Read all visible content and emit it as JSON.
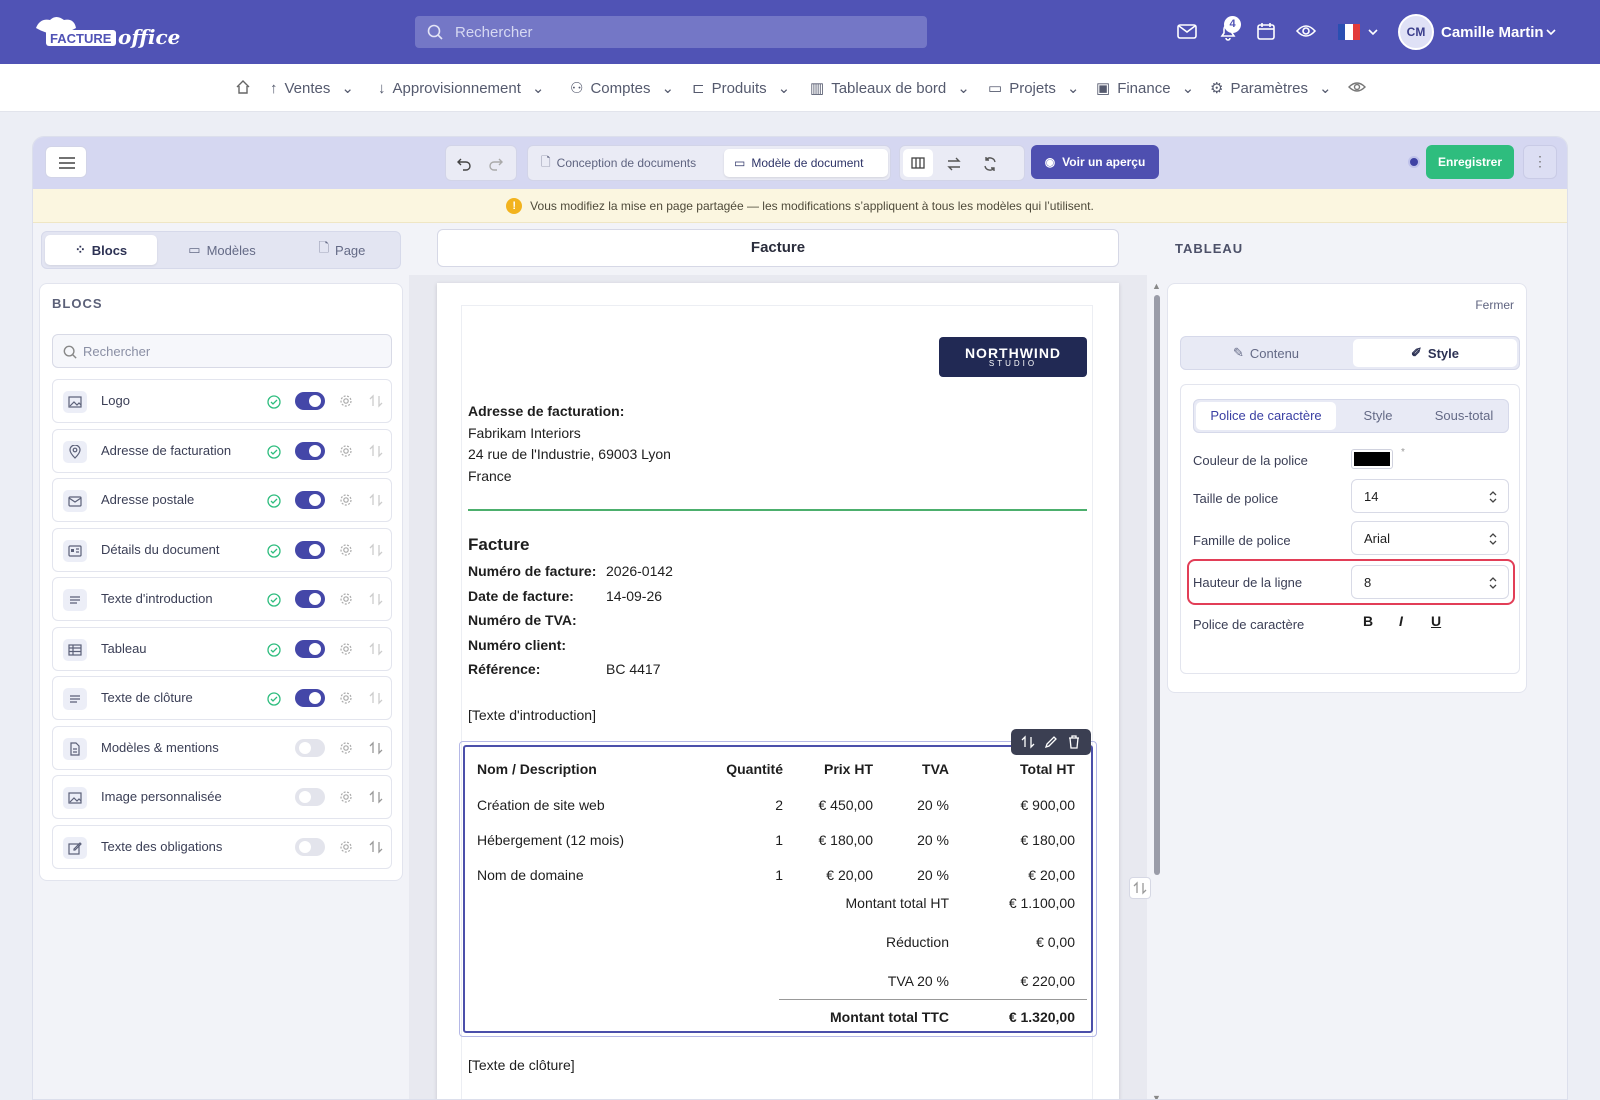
{
  "header": {
    "logo_text": "FACTURE office",
    "search_placeholder": "Rechercher",
    "notification_count": "4",
    "user_initials": "CM",
    "user_name": "Camille Martin"
  },
  "nav": {
    "items": [
      "Ventes",
      "Approvisionnement",
      "Comptes",
      "Produits",
      "Tableaux de bord",
      "Projets",
      "Finance",
      "Paramètres"
    ]
  },
  "toolbar": {
    "tab_design": "Conception de documents",
    "tab_template": "Modèle de document",
    "preview_label": "Voir un aperçu",
    "save_label": "Enregistrer",
    "more_label": "⋮"
  },
  "warning": {
    "icon": "!",
    "text": "Vous modifiez la mise en page partagée — les modifications s’appliquent à tous les modèles qui l’utilisent."
  },
  "left": {
    "tabs": [
      "Blocs",
      "Modèles",
      "Page"
    ],
    "section_title": "BLOCS",
    "search_placeholder": "Rechercher",
    "blocks": [
      {
        "label": "Logo",
        "icon": "image-icon",
        "enabled": true
      },
      {
        "label": "Adresse de facturation",
        "icon": "location-pin-icon",
        "enabled": true
      },
      {
        "label": "Adresse postale",
        "icon": "envelope-icon",
        "enabled": true
      },
      {
        "label": "Détails du document",
        "icon": "id-card-icon",
        "enabled": true
      },
      {
        "label": "Texte d'introduction",
        "icon": "text-lines-icon",
        "enabled": true
      },
      {
        "label": "Tableau",
        "icon": "table-icon",
        "enabled": true
      },
      {
        "label": "Texte de clôture",
        "icon": "text-lines-icon",
        "enabled": true
      },
      {
        "label": "Modèles & mentions",
        "icon": "document-icon",
        "enabled": false
      },
      {
        "label": "Image personnalisée",
        "icon": "image-icon",
        "enabled": false
      },
      {
        "label": "Texte des obligations",
        "icon": "edit-icon",
        "enabled": false
      }
    ]
  },
  "document": {
    "title": "Facture",
    "logo_name": "NORTHWIND",
    "logo_sub": "STUDIO",
    "billing_heading": "Adresse de facturation:",
    "billing_lines": [
      "Fabrikam Interiors",
      "24 rue de l'Industrie, 69003 Lyon",
      "France"
    ],
    "invoice_title": "Facture",
    "meta": [
      {
        "label": "Numéro de facture:",
        "value": "2026-0142"
      },
      {
        "label": "Date de facture:",
        "value": "14-09-26"
      },
      {
        "label": "Numéro de TVA:",
        "value": ""
      },
      {
        "label": "Numéro client:",
        "value": ""
      },
      {
        "label": "Référence:",
        "value": "BC 4417"
      }
    ],
    "intro_placeholder": "[Texte d'introduction]",
    "closing_placeholder": "[Texte de clôture]",
    "table": {
      "headers": [
        "Nom / Description",
        "Quantité",
        "Prix HT",
        "TVA",
        "Total HT"
      ],
      "rows": [
        [
          "Création de site web",
          "2",
          "€ 450,00",
          "20 %",
          "€ 900,00"
        ],
        [
          "Hébergement (12 mois)",
          "1",
          "€ 180,00",
          "20 %",
          "€ 180,00"
        ],
        [
          "Nom de domaine",
          "1",
          "€ 20,00",
          "20 %",
          "€ 20,00"
        ]
      ],
      "totals": [
        {
          "label": "Montant total HT",
          "value": "€ 1.100,00"
        },
        {
          "label": "Réduction",
          "value": "€ 0,00"
        },
        {
          "label": "TVA 20 %",
          "value": "€ 220,00"
        }
      ],
      "grand_total": {
        "label": "Montant total TTC",
        "value": "€ 1.320,00"
      }
    }
  },
  "right": {
    "title": "TABLEAU",
    "close_label": "Fermer",
    "tabs": [
      "Contenu",
      "Style"
    ],
    "subtabs": [
      "Police de caractère",
      "Style",
      "Sous-total"
    ],
    "font_color_label": "Couleur de la police",
    "font_color": "#000000",
    "font_size_label": "Taille de police",
    "font_size": "14",
    "font_family_label": "Famille de police",
    "font_family": "Arial",
    "line_height_label": "Hauteur de la ligne",
    "line_height": "8",
    "format_label": "Police de caractère",
    "bold": "B",
    "italic": "I",
    "underline": "U"
  },
  "colors": {
    "brand": "#5053b5",
    "save": "#2ebd7e",
    "highlight": "#e23e57",
    "divider": "#4caf6d"
  }
}
